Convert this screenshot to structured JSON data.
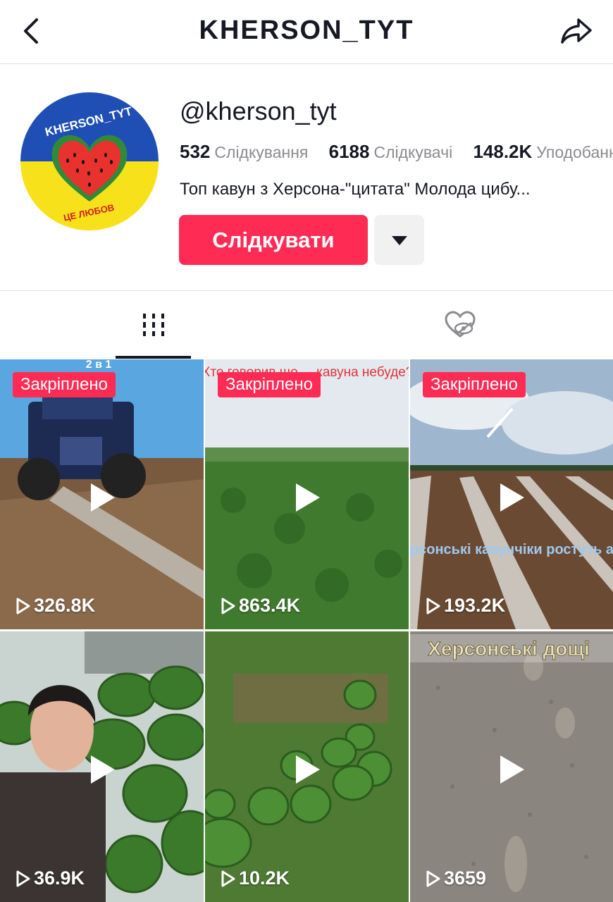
{
  "header": {
    "title": "KHERSON_TYT"
  },
  "profile": {
    "avatar_text_top": "KHERSON_TYT",
    "avatar_text_bottom": "ЦЕ ЛЮБОВ",
    "username": "@kherson_tyt",
    "stats": [
      {
        "value": "532",
        "label": "Слідкування"
      },
      {
        "value": "6188",
        "label": "Слідкувачі"
      },
      {
        "value": "148.2K",
        "label": "Уподобання"
      }
    ],
    "bio": "Топ кавун з Херсона-\"цитата\" Молода цибу...",
    "follow_label": "Слідкувати"
  },
  "tabs": [
    {
      "icon": "grid-icon",
      "active": true
    },
    {
      "icon": "liked-hidden-icon",
      "active": false
    }
  ],
  "videos": [
    {
      "pinned_label": "Закріплено",
      "views": "326.8K",
      "overlay": "2 в 1"
    },
    {
      "pinned_label": "Закріплено",
      "views": "863.4K",
      "overlay": "Хто говорив що ... кавуна небуде?"
    },
    {
      "pinned_label": "Закріплено",
      "views": "193.2K",
      "overlay": "Херсонські кавунчіки ростуть але"
    },
    {
      "pinned_label": "",
      "views": "36.9K",
      "overlay": ""
    },
    {
      "pinned_label": "",
      "views": "10.2K",
      "overlay": ""
    },
    {
      "pinned_label": "",
      "views": "3659",
      "overlay": "Херсонські дощі"
    }
  ],
  "colors": {
    "accent": "#fe2c55",
    "text": "#161823",
    "muted": "#8a8b91"
  }
}
